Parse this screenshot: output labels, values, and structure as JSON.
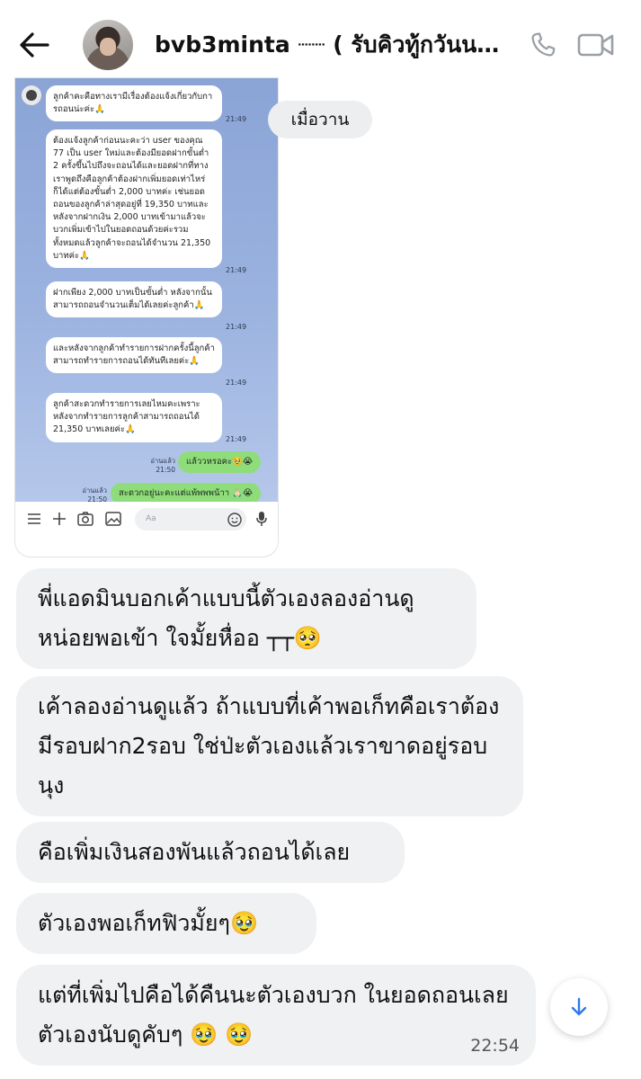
{
  "header": {
    "title": "bvb3minta ┈┈ ( รับคิวทู้กวันน )…",
    "icons": {
      "back": "back-arrow-icon",
      "call": "phone-icon",
      "video": "video-camera-icon"
    }
  },
  "date_divider": "เมื่อวาน",
  "embedded_screenshot": {
    "incoming": [
      {
        "text": "ลูกค้าคะคือทางเรามีเรื่องต้องแจ้งเกี่ยวกับการถอนน่ะค่ะ🙏",
        "time": "21:49"
      },
      {
        "text": "ต้องแจ้งลูกค้าก่อนนะคะว่า user ของคุณ 77 เป็น user ใหม่และต้องมียอดฝากขั้นต่ำ 2 ครั้งขึ้นไปถึงจะถอนได้และยอดฝากที่ทางเราพูดถึงคือลูกค้าต้องฝากเพิ่มยอดเท่าไหร่ก็ได้แต่ต้องขั้นต่ำ 2,000 บาทค่ะ เช่นยอดถอนของลูกค้าล่าสุดอยู่ที่ 19,350 บาทและหลังจากฝากเงิน 2,000 บาทเข้ามาแล้วจะบวกเพิ่มเข้าไปในยอดถอนด้วยค่ะรวมทั้งหมดแล้วลูกค้าจะถอนได้จำนวน 21,350 บาทค่ะ🙏",
        "time": "21:49"
      },
      {
        "text": "ฝากเพียง 2,000 บาทเป็นขั้นต่ำ หลังจากนั้นสามารถถอนจำนวนเต็มได้เลยค่ะลูกค้า🙏",
        "time": "21:49"
      },
      {
        "text": "และหลังจากลูกค้าทำรายการฝากครั้งนี้ลูกค้าสามารถทำรายการถอนได้ทันทีเลยค่ะ🙏",
        "time": "21:49"
      },
      {
        "text": "ลูกค้าสะดวกทำรายการเลยไหมคะเพราะหลังจากทำรายการลูกค้าสามารถถอนได้ 21,350 บาทเลยค่ะ🙏",
        "time": "21:49"
      }
    ],
    "outgoing": [
      {
        "text": "แล้ววหรอคะ🥹😭",
        "read": "อ่านแล้ว",
        "time": "21:50"
      },
      {
        "text": "สะดวกอยู่นะคะแต่แพ้พพพน้าา 🙏🏻😭",
        "read": "อ่านแล้ว",
        "time": "21:50"
      }
    ],
    "input_placeholder": "Aa",
    "toolbar_icons": [
      "menu-icon",
      "plus-icon",
      "camera-icon",
      "image-icon",
      "emoji-icon",
      "microphone-icon"
    ]
  },
  "messages": [
    {
      "text": "พี่แอดมินบอกเค้าแบบนี้ตัวเองลองอ่านดูหน่อยพอเข้า ใจมั้ยหื่ออ ┬┬🥺"
    },
    {
      "text": "เค้าลองอ่านดูแล้ว ถ้าแบบที่เค้าพอเก็ทคือเราต้องมีรอบฝาก2รอบ ใช่ป่ะตัวเองแล้วเราขาดอยู่รอบนุง"
    },
    {
      "text": "คือเพิ่มเงินสองพันแล้วถอนได้เลย"
    },
    {
      "text": "ตัวเองพอเก็ทฟิวมั้ยๆ🥹"
    },
    {
      "text": "แต่ที่เพิ่มไปคือได้คืนนะตัวเองบวก ในยอดถอนเลยตัวเองนับดูคับๆ 🥹 🥹",
      "time": "22:54"
    }
  ],
  "scroll_button_icon": "arrow-down-icon"
}
